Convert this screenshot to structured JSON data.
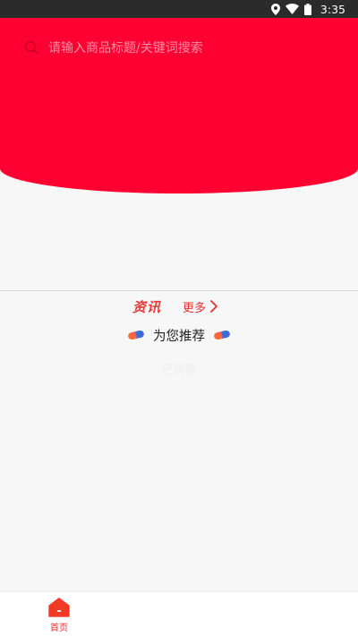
{
  "status_bar": {
    "time": "3:35"
  },
  "search": {
    "placeholder": "请输入商品标题/关键词搜索"
  },
  "news": {
    "title": "资讯",
    "more_label": "更多"
  },
  "recommend": {
    "title": "为您推荐"
  },
  "ghost": {
    "text": "已售罄"
  },
  "tabbar": {
    "home_label": "首页"
  },
  "icons": {
    "status": [
      "location-icon",
      "wifi-icon",
      "battery-icon"
    ],
    "search": "search-icon",
    "more": "chevron-right-icon",
    "home": "home-icon"
  },
  "colors": {
    "hero": "#ff0033",
    "accent": "#e0302e",
    "background": "#f7f7f7"
  }
}
